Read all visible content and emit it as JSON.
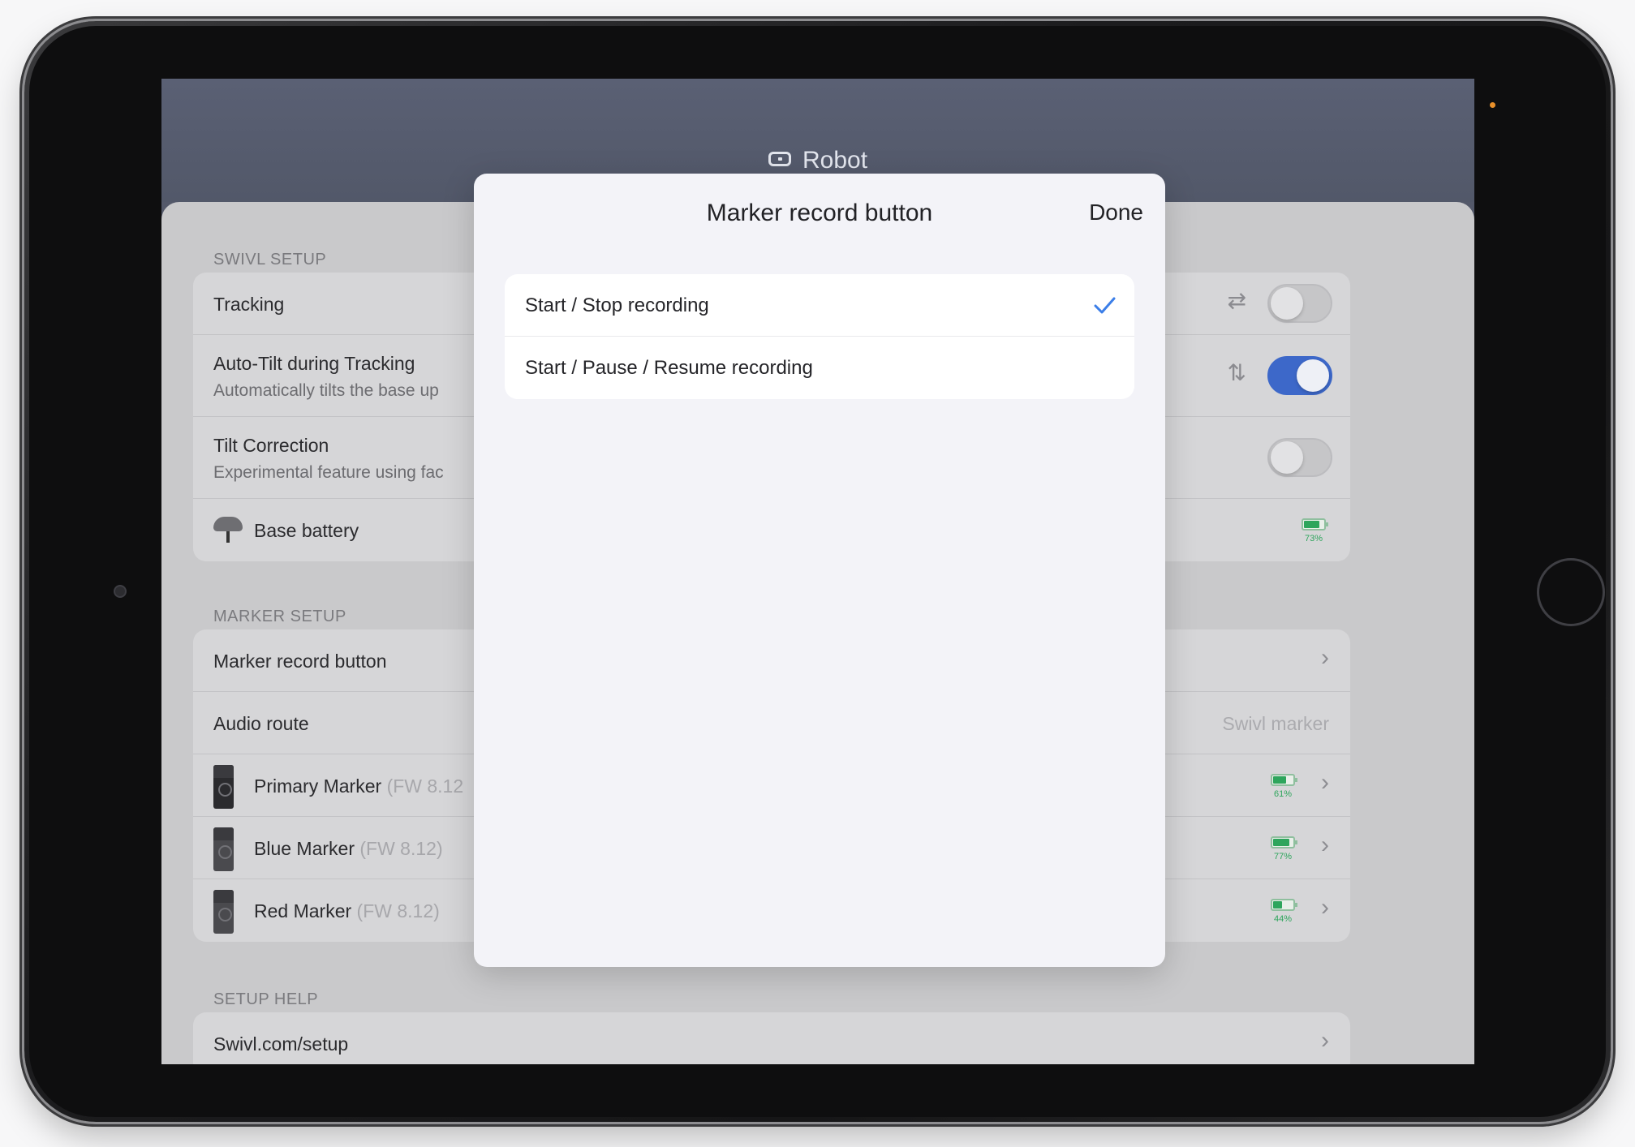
{
  "app": {
    "title": "Robot"
  },
  "swivl_setup": {
    "header": "SWIVL SETUP",
    "rows": {
      "tracking": {
        "label": "Tracking",
        "icon": "swap-arrows-icon",
        "enabled": false
      },
      "auto_tilt": {
        "label": "Auto-Tilt during Tracking",
        "sub": "Automatically tilts the base up",
        "icon": "up-down-arrows-icon",
        "enabled": true
      },
      "tilt_correction": {
        "label": "Tilt Correction",
        "sub": "Experimental feature using fac",
        "enabled": false
      },
      "base_battery": {
        "label": "Base battery",
        "battery_pct": "73%",
        "battery_level": 0.73
      }
    }
  },
  "marker_setup": {
    "header": "MARKER SETUP",
    "rows": {
      "record_button": {
        "label": "Marker record button"
      },
      "audio_route": {
        "label": "Audio route",
        "value": "Swivl marker"
      },
      "primary": {
        "name": "Primary Marker",
        "fw": "(FW 8.12",
        "battery_pct": "61%",
        "battery_level": 0.61
      },
      "blue": {
        "name": "Blue Marker",
        "fw": "(FW 8.12)",
        "battery_pct": "77%",
        "battery_level": 0.77
      },
      "red": {
        "name": "Red Marker",
        "fw": "(FW 8.12)",
        "battery_pct": "44%",
        "battery_level": 0.44
      }
    }
  },
  "setup_help": {
    "header": "SETUP HELP",
    "link": "Swivl.com/setup"
  },
  "modal": {
    "title": "Marker record button",
    "done_label": "Done",
    "options": [
      {
        "label": "Start / Stop recording",
        "selected": true
      },
      {
        "label": "Start / Pause / Resume recording",
        "selected": false
      }
    ]
  },
  "colors": {
    "accent": "#3d68c9",
    "battery_green": "#2ea55c",
    "checkmark": "#3b7ee8"
  }
}
